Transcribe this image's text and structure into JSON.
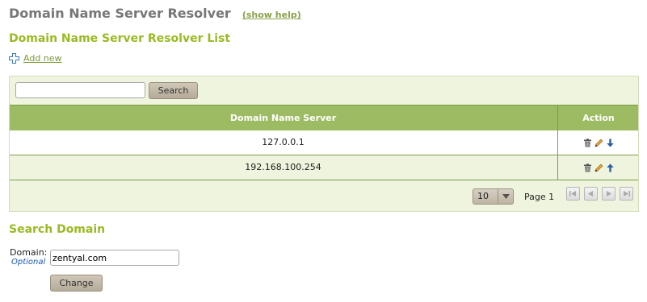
{
  "header": {
    "title": "Domain Name Server Resolver",
    "help_link": "(show help)"
  },
  "list": {
    "title": "Domain Name Server Resolver List",
    "add_new": "Add new",
    "search": {
      "value": "",
      "button": "Search"
    },
    "columns": {
      "dns": "Domain Name Server",
      "action": "Action"
    },
    "rows": [
      {
        "dns": "127.0.0.1",
        "actions": [
          "delete-icon",
          "edit-icon",
          "move-down-icon"
        ]
      },
      {
        "dns": "192.168.100.254",
        "actions": [
          "delete-icon",
          "edit-icon",
          "move-up-icon"
        ]
      }
    ],
    "pager": {
      "page_size": "10",
      "page_label": "Page 1"
    }
  },
  "search_domain": {
    "title": "Search Domain",
    "label": "Domain:",
    "optional": "Optional",
    "value": "zentyal.com",
    "button": "Change"
  },
  "colors": {
    "accent": "#99bb22",
    "header_bg": "#9dbb63",
    "panel_bg": "#eef4dd",
    "link_optional": "#1a5bb3"
  }
}
